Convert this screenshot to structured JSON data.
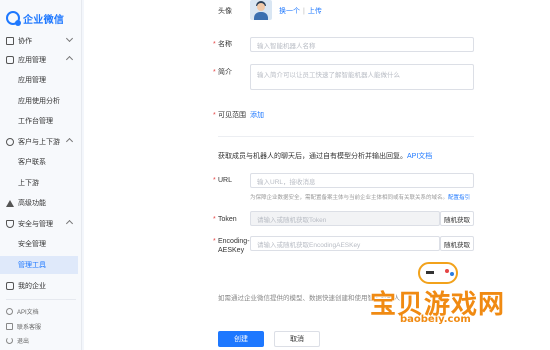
{
  "brand": {
    "name": "企业微信"
  },
  "sidebar": {
    "groups": [
      {
        "label": "协作",
        "icon": "collab-icon",
        "expanded": false
      },
      {
        "label": "应用管理",
        "icon": "app-icon",
        "expanded": true,
        "items": [
          "应用管理",
          "应用使用分析",
          "工作台管理"
        ]
      },
      {
        "label": "客户与上下游",
        "icon": "customer-icon",
        "expanded": true,
        "items": [
          "客户联系",
          "上下游"
        ]
      },
      {
        "label": "高级功能",
        "icon": "advanced-icon",
        "expanded": false
      },
      {
        "label": "安全与管理",
        "icon": "security-icon",
        "expanded": true,
        "items": [
          "安全管理",
          "管理工具"
        ],
        "active_item": "管理工具"
      },
      {
        "label": "我的企业",
        "icon": "company-icon",
        "expanded": false
      }
    ],
    "footer": [
      {
        "label": "API文档",
        "icon": "api-doc-icon"
      },
      {
        "label": "联系客服",
        "icon": "contact-icon"
      },
      {
        "label": "退出",
        "icon": "logout-icon"
      }
    ]
  },
  "form": {
    "avatar": {
      "label": "头像",
      "change": "换一个",
      "upload": "上传"
    },
    "name": {
      "label": "名称",
      "placeholder": "输入智能机器人名称"
    },
    "intro": {
      "label": "简介",
      "placeholder": "输入简介可以让员工快速了解智能机器人能做什么"
    },
    "visible": {
      "label": "可见范围",
      "action": "添加"
    },
    "callback_note": "获取成员与机器人的聊天后，通过自有模型分析并输出回复。",
    "callback_link": "API文档",
    "url": {
      "label": "URL",
      "placeholder": "输入URL，接收消息",
      "hint": "为保障企业数据安全，需配置备案主体与当前企业主体相同或有关联关系的域名。",
      "hint_link": "配置指引"
    },
    "token": {
      "label": "Token",
      "placeholder": "请输入或随机获取Token",
      "button": "随机获取"
    },
    "aeskey": {
      "label_1": "Encoding-",
      "label_2": "AESKey",
      "placeholder": "请输入或随机获取EncodingAESKey",
      "button": "随机获取"
    },
    "footnote": "如需通过企业微信提供的模型、数据快速创建和使用智能机器人",
    "create": "创建",
    "cancel": "取消"
  },
  "watermark": {
    "title": "宝贝游戏网",
    "domain": "baobeiy.com"
  },
  "colors": {
    "accent": "#1e78ff",
    "required": "#e54545",
    "watermark": "#f08a12"
  }
}
